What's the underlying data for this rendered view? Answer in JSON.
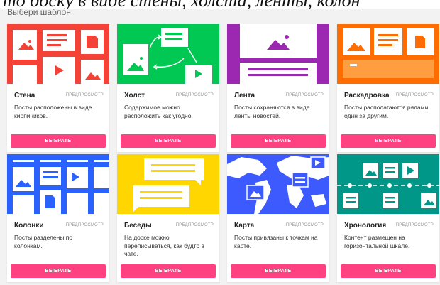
{
  "caption": "то доску в виде стены, холста, ленты, колон",
  "header": {
    "title": "Выбери шаблон"
  },
  "colors": {
    "wall": "#f44336",
    "canvas": "#00c853",
    "stream": "#9c27b0",
    "storyboard": "#ff6d00",
    "columns": "#2962ff",
    "chat": "#ffd600",
    "map": "#3d5afe",
    "timeline": "#009688",
    "button": "#ff4081"
  },
  "templates": [
    {
      "name": "Стена",
      "preview": "ПРЕДПРОСМОТР",
      "description": "Посты расположены в виде кирпичиков.",
      "button": "ВЫБРАТЬ",
      "icon": "wall-layout-icon"
    },
    {
      "name": "Холст",
      "preview": "ПРЕДПРОСМОТР",
      "description": "Содержимое можно расположить как угодно.",
      "button": "ВЫБРАТЬ",
      "icon": "canvas-layout-icon"
    },
    {
      "name": "Лента",
      "preview": "ПРЕДПРОСМОТР",
      "description": "Посты сохраняются в виде ленты новостей.",
      "button": "ВЫБРАТЬ",
      "icon": "stream-layout-icon"
    },
    {
      "name": "Раскадровка",
      "preview": "ПРЕДПРОСМОТР",
      "description": "Посты располагаются рядами один за другим.",
      "button": "ВЫБРАТЬ",
      "icon": "storyboard-layout-icon"
    },
    {
      "name": "Колонки",
      "preview": "ПРЕДПРОСМОТР",
      "description": "Посты разделены по колонкам.",
      "button": "ВЫБРАТЬ",
      "icon": "columns-layout-icon"
    },
    {
      "name": "Беседы",
      "preview": "ПРЕДПРОСМОТР",
      "description": "На доске можно переписываться, как будто в чате.",
      "button": "ВЫБРАТЬ",
      "icon": "chat-layout-icon"
    },
    {
      "name": "Карта",
      "preview": "ПРЕДПРОСМОТР",
      "description": "Посты привязаны к точкам на карте.",
      "button": "ВЫБРАТЬ",
      "icon": "map-layout-icon"
    },
    {
      "name": "Хронология",
      "preview": "ПРЕДПРОСМОТР",
      "description": "Контент размещен на горизонтальной шкале.",
      "button": "ВЫБРАТЬ",
      "icon": "timeline-layout-icon"
    }
  ]
}
